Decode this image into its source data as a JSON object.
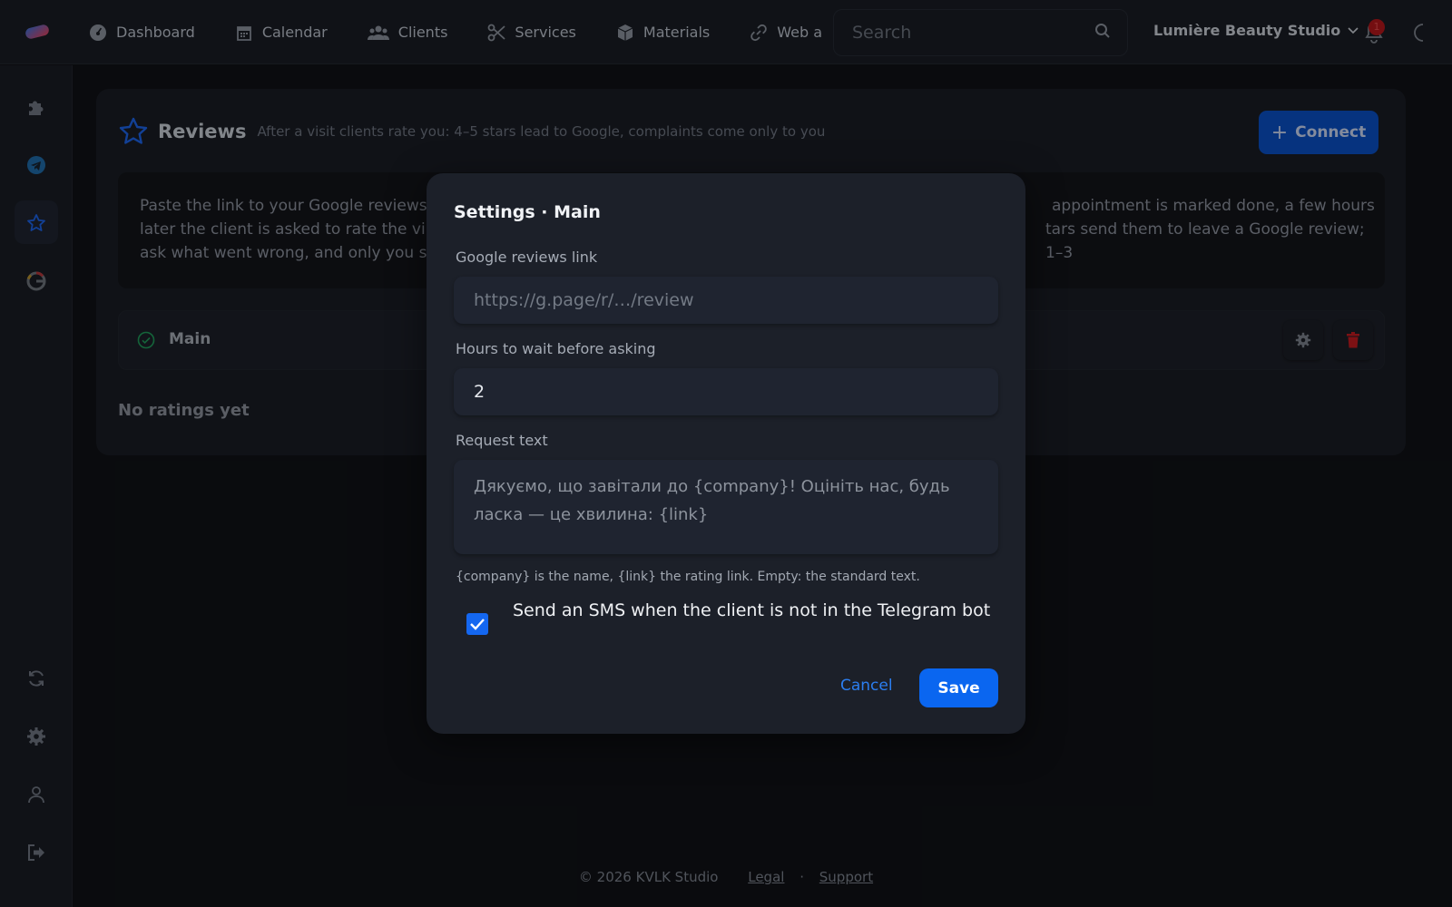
{
  "topbar": {
    "nav": [
      {
        "label": "Dashboard",
        "icon": "dashboard-icon"
      },
      {
        "label": "Calendar",
        "icon": "calendar-icon"
      },
      {
        "label": "Clients",
        "icon": "users-icon"
      },
      {
        "label": "Services",
        "icon": "scissors-icon"
      },
      {
        "label": "Materials",
        "icon": "box-icon"
      },
      {
        "label": "Web a",
        "icon": "link-icon"
      }
    ],
    "search_placeholder": "Search",
    "studio_name": "Lumière Beauty Studio",
    "notification_count": "1"
  },
  "sidebar": {
    "items": [
      "puzzle-icon",
      "telegram-icon",
      "star-icon",
      "google-icon",
      "refresh-icon",
      "gear-icon",
      "user-icon",
      "logout-icon"
    ],
    "active": "star-icon"
  },
  "reviews": {
    "title": "Reviews",
    "subtitle": "After a visit clients rate you: 4–5 stars lead to Google, complaints come only to you",
    "connect_label": "Connect",
    "info_line1_left": "Paste the link to your Google reviews",
    "info_line1_right": "appointment is marked done, a few hours",
    "info_line2_left": "later the client is asked to rate the vi",
    "info_line2_right": "tars send them to leave a Google review; 1–3",
    "info_line3_left": "ask what went wrong, and only you s",
    "integration_name": "Main",
    "empty_text": "No ratings yet"
  },
  "modal": {
    "title": "Settings · Main",
    "google_link_label": "Google reviews link",
    "google_link_placeholder": "https://g.page/r/…/review",
    "google_link_value": "",
    "hours_label": "Hours to wait before asking",
    "hours_value": "2",
    "request_label": "Request text",
    "request_placeholder": "Дякуємо, що завітали до {company}! Оцініть нас, будь ласка — це хвилина: {link}",
    "hint": "{company} is the name, {link} the rating link. Empty: the standard text.",
    "sms_label": "Send an SMS when the client is not in the Telegram bot",
    "sms_checked": true,
    "cancel_label": "Cancel",
    "save_label": "Save"
  },
  "footer": {
    "copyright": "© 2026 KVLK Studio",
    "legal": "Legal",
    "dot": "·",
    "support": "Support"
  },
  "colors": {
    "accent": "#0a66f0",
    "danger": "#c01b20",
    "success": "#1f9a5a"
  }
}
